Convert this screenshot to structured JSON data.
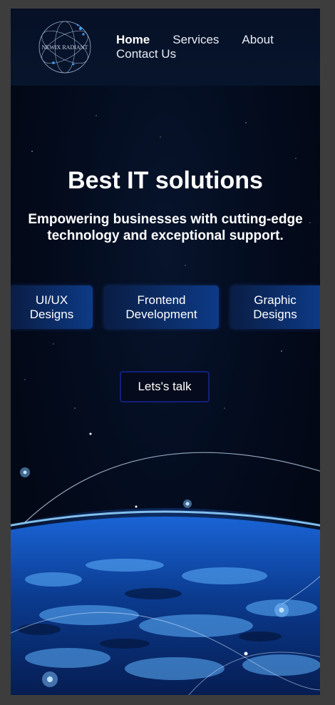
{
  "header": {
    "logo_text": "NEWIX RADIANT",
    "nav": {
      "home": "Home",
      "services": "Services",
      "about": "About",
      "contact": "Contact Us"
    }
  },
  "hero": {
    "title": "Best IT solutions",
    "subtitle": "Empowering businesses with cutting-edge technology and exceptional support.",
    "services": [
      {
        "label": "UI/UX Designs"
      },
      {
        "label": "Frontend Development"
      },
      {
        "label": "Graphic Designs"
      }
    ],
    "cta_label": "Lets's talk"
  },
  "colors": {
    "background": "#030a1b",
    "button_gradient_end": "#0d3a86",
    "cta_border": "#131f7a",
    "text": "#ffffff"
  }
}
